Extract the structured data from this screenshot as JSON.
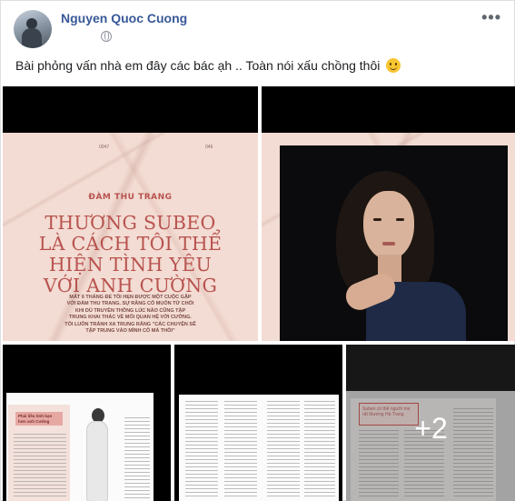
{
  "post": {
    "author": "Nguyen Quoc Cuong",
    "time": "",
    "caption": "Bài phỏng vấn nhà em đây các bác ạh .. Toàn nói xấu chồng thôi",
    "more_label": "•••",
    "privacy_icon": "globe-icon",
    "emoji_icon": "smile-emoji-icon"
  },
  "photos": {
    "tile1": {
      "page_left": "0047",
      "page_right": "049",
      "kicker": "ĐÀM THU TRANG",
      "headline": "THƯƠNG SUBEO\nLÀ CÁCH TÔI THỂ\nHIỆN TÌNH YÊU\nVỚI ANH CƯỜNG",
      "dek": "MẤT 6 THÁNG ĐỂ TÔI HẸN ĐƯỢC MỘT CUỘC GẶP\nVỚI ĐÀM THU TRANG. SỰ RẰNG CÔ MUỐN TỪ CHỐI\nKHI DÙ TRUYỀN THÔNG LÚC NÀO CŨNG TẬP\nTRUNG KHAI THÁC VỀ MỐI QUAN HỆ VỚI CƯỜNG.\nTÔI LUÔN TRÁNH XA TRUNG RẰNG \"CÁC CHUYỆN SẼ\nTẬP TRUNG VÀO MÌNH CÔ MÀ THÔI\""
    },
    "tile3": {
      "tag": "Phải liều tình bạn hơn anh Cường"
    },
    "tile5": {
      "box": "Subeo có thể người mẹ rất thương Hà Trang",
      "more_count": "+2"
    }
  }
}
